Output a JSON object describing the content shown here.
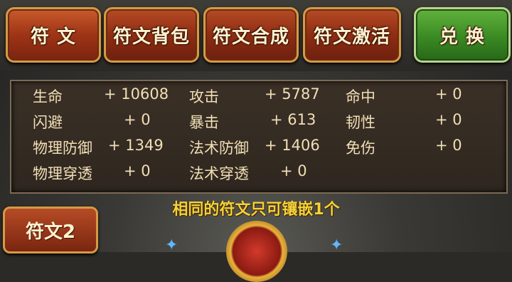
{
  "tabs": [
    {
      "label": "符 文"
    },
    {
      "label": "符文背包"
    },
    {
      "label": "符文合成"
    },
    {
      "label": "符文激活"
    }
  ],
  "exchange_label": "兑 换",
  "stats": [
    [
      {
        "name": "生命",
        "value": "+ 10608"
      },
      {
        "name": "攻击",
        "value": "+ 5787"
      },
      {
        "name": "命中",
        "value": "+ 0"
      }
    ],
    [
      {
        "name": "闪避",
        "value": "+ 0"
      },
      {
        "name": "暴击",
        "value": "+ 613"
      },
      {
        "name": "韧性",
        "value": "+ 0"
      }
    ],
    [
      {
        "name": "物理防御",
        "value": "+ 1349"
      },
      {
        "name": "法术防御",
        "value": "+ 1406"
      },
      {
        "name": "免伤",
        "value": "+ 0"
      }
    ],
    [
      {
        "name": "物理穿透",
        "value": "+ 0"
      },
      {
        "name": "法术穿透",
        "value": "+ 0"
      }
    ]
  ],
  "notice": "相同的符文只可镶嵌1个",
  "subtab_label": "符文2"
}
